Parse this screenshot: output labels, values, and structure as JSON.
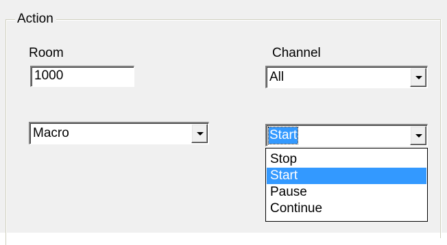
{
  "group": {
    "legend": "Action"
  },
  "room": {
    "label": "Room",
    "value": "1000"
  },
  "channel": {
    "label": "Channel",
    "value": "All"
  },
  "type_combo": {
    "value": "Macro"
  },
  "command_combo": {
    "value": "Start",
    "options": [
      "Stop",
      "Start",
      "Pause",
      "Continue"
    ],
    "highlighted_index": 1
  },
  "colors": {
    "highlight": "#3399ff",
    "dialog_bg": "#f0f0f0"
  },
  "icons": {
    "dropdown_arrow": "chevron-down-icon"
  }
}
